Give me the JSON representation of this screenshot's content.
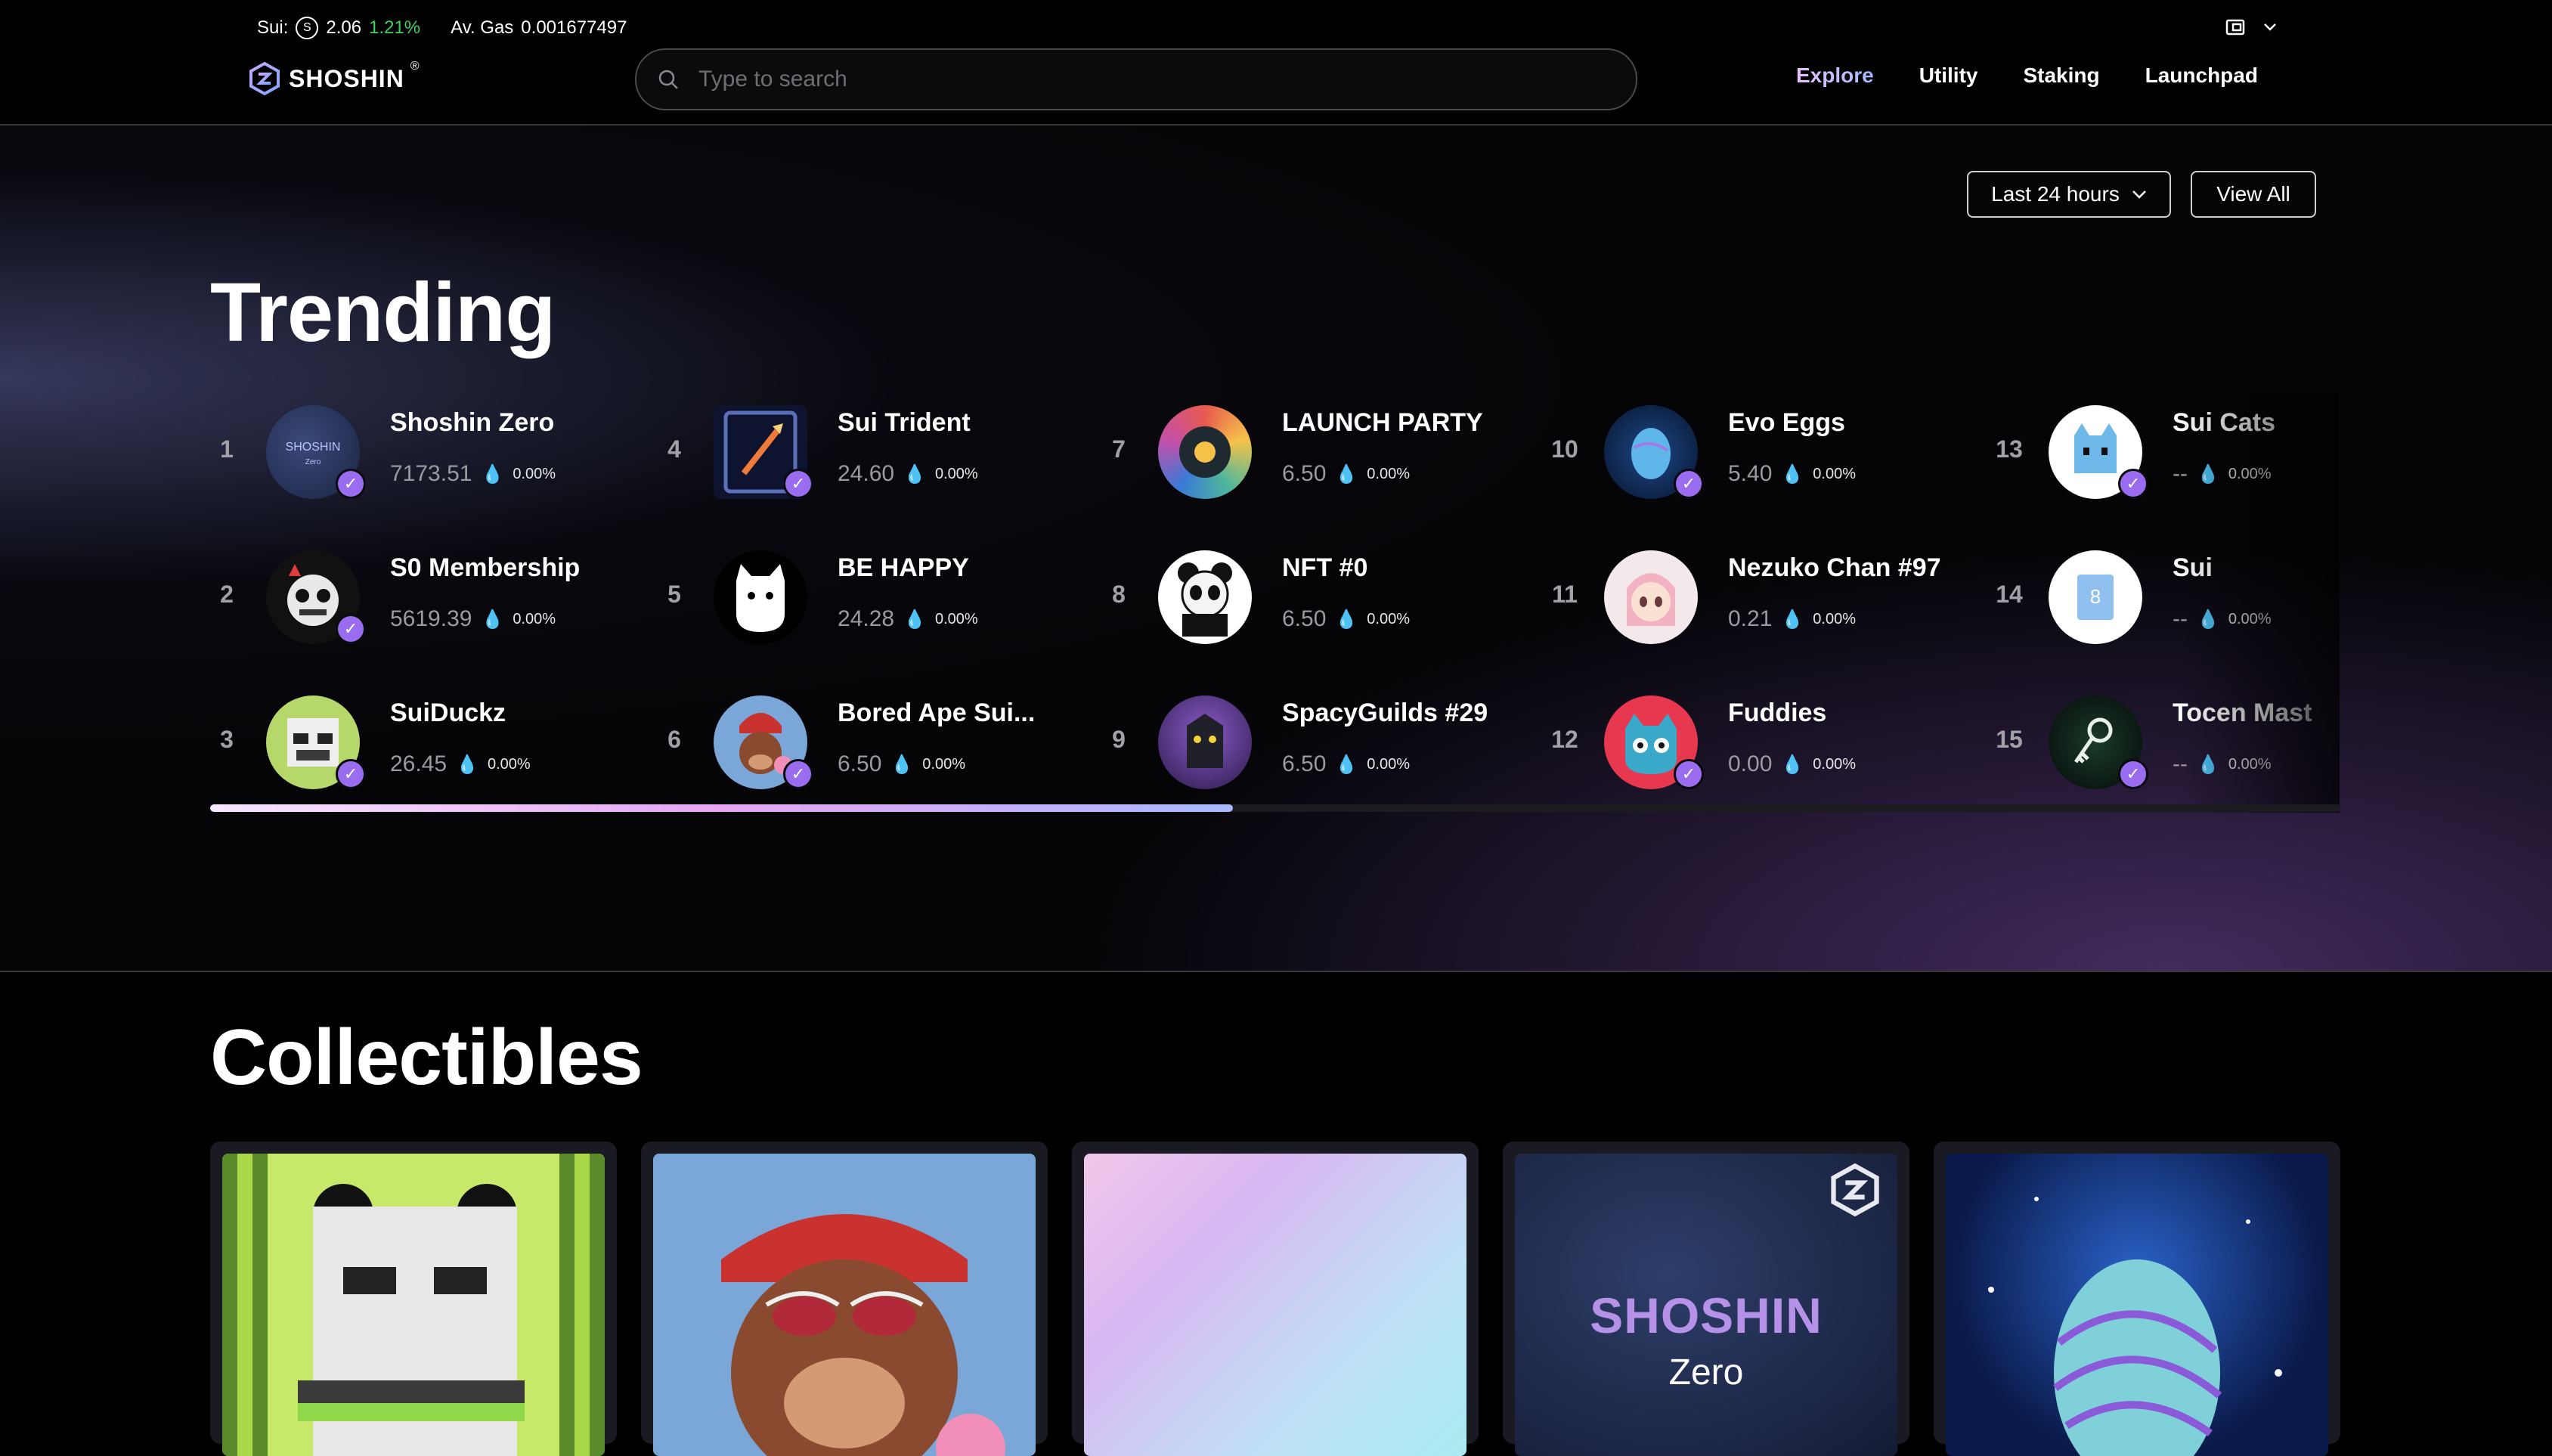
{
  "header": {
    "sui_label": "Sui:",
    "sui_price": "2.06",
    "sui_change": "1.21%",
    "gas_label": "Av. Gas",
    "gas_value": "0.001677497",
    "logo_text": "SHOSHIN",
    "logo_reg": "®",
    "search_placeholder": "Type to search",
    "nav": [
      "Explore",
      "Utility",
      "Staking",
      "Launchpad"
    ],
    "active_nav": "Explore"
  },
  "trending": {
    "title": "Trending",
    "period": "Last 24 hours",
    "view_all": "View All",
    "items": [
      {
        "rank": "1",
        "name": "Shoshin Zero",
        "price": "7173.51",
        "change": "0.00%",
        "verified": true
      },
      {
        "rank": "2",
        "name": "S0 Membership",
        "price": "5619.39",
        "change": "0.00%",
        "verified": true
      },
      {
        "rank": "3",
        "name": "SuiDuckz",
        "price": "26.45",
        "change": "0.00%",
        "verified": true
      },
      {
        "rank": "4",
        "name": "Sui Trident",
        "price": "24.60",
        "change": "0.00%",
        "verified": true
      },
      {
        "rank": "5",
        "name": "BE HAPPY",
        "price": "24.28",
        "change": "0.00%",
        "verified": false
      },
      {
        "rank": "6",
        "name": "Bored Ape Sui...",
        "price": "6.50",
        "change": "0.00%",
        "verified": true
      },
      {
        "rank": "7",
        "name": "LAUNCH PARTY",
        "price": "6.50",
        "change": "0.00%",
        "verified": false
      },
      {
        "rank": "8",
        "name": "NFT #0",
        "price": "6.50",
        "change": "0.00%",
        "verified": false
      },
      {
        "rank": "9",
        "name": "SpacyGuilds #29",
        "price": "6.50",
        "change": "0.00%",
        "verified": false
      },
      {
        "rank": "10",
        "name": "Evo Eggs",
        "price": "5.40",
        "change": "0.00%",
        "verified": true
      },
      {
        "rank": "11",
        "name": "Nezuko Chan #97",
        "price": "0.21",
        "change": "0.00%",
        "verified": false
      },
      {
        "rank": "12",
        "name": "Fuddies",
        "price": "0.00",
        "change": "0.00%",
        "verified": true
      },
      {
        "rank": "13",
        "name": "Sui Cats",
        "price": "--",
        "change": "0.00%",
        "verified": true
      },
      {
        "rank": "14",
        "name": "Sui",
        "price": "--",
        "change": "0.00%",
        "verified": false
      },
      {
        "rank": "15",
        "name": "Tocen Mast",
        "price": "--",
        "change": "0.00%",
        "verified": true
      }
    ],
    "scroll_fraction": 0.48
  },
  "collectibles": {
    "title": "Collectibles",
    "cards": [
      {
        "art": "panda-pixel"
      },
      {
        "art": "bored-ape"
      },
      {
        "art": "gradient"
      },
      {
        "art": "shoshin-zero",
        "title": "SHOSHIN",
        "subtitle": "Zero"
      },
      {
        "art": "evo-egg"
      }
    ]
  },
  "colors": {
    "accent": "#9a6cf0",
    "positive": "#3ecf5e",
    "muted": "#9a9aa0"
  }
}
